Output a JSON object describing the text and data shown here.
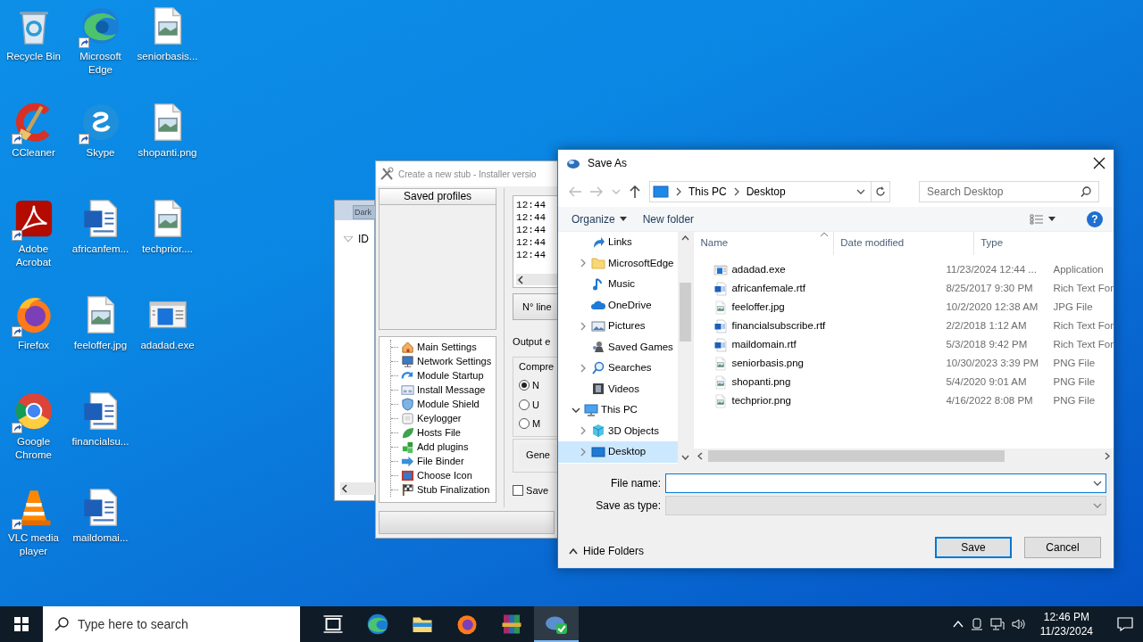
{
  "desktop_icons": [
    {
      "label": "Recycle Bin",
      "kind": "recycle",
      "shortcut": false
    },
    {
      "label": "CCleaner",
      "kind": "ccleaner",
      "shortcut": true
    },
    {
      "label": "Adobe Acrobat",
      "kind": "acrobat",
      "shortcut": true
    },
    {
      "label": "Firefox",
      "kind": "firefox",
      "shortcut": true
    },
    {
      "label": "Google Chrome",
      "kind": "chrome",
      "shortcut": true
    },
    {
      "label": "VLC media player",
      "kind": "vlc",
      "shortcut": true
    },
    {
      "label": "Microsoft Edge",
      "kind": "edge",
      "shortcut": true
    },
    {
      "label": "Skype",
      "kind": "skype",
      "shortcut": true
    },
    {
      "label": "africanfem...",
      "kind": "word",
      "shortcut": false
    },
    {
      "label": "feeloffer.jpg",
      "kind": "image",
      "shortcut": false
    },
    {
      "label": "financialsu...",
      "kind": "word",
      "shortcut": false
    },
    {
      "label": "maildomai...",
      "kind": "word",
      "shortcut": false
    },
    {
      "label": "seniorbasis...",
      "kind": "image",
      "shortcut": false
    },
    {
      "label": "shopanti.png",
      "kind": "image",
      "shortcut": false
    },
    {
      "label": "techprior....",
      "kind": "image",
      "shortcut": false
    },
    {
      "label": "adadad.exe",
      "kind": "exe",
      "shortcut": false
    }
  ],
  "back_window": {
    "button": "Dark",
    "column": "ID"
  },
  "stub_window": {
    "title": "Create a new stub - Installer versio",
    "profiles_header": "Saved profiles",
    "tree": [
      {
        "label": "Main Settings",
        "kind": "house"
      },
      {
        "label": "Network Settings",
        "kind": "monitor"
      },
      {
        "label": "Module Startup",
        "kind": "arrows"
      },
      {
        "label": "Install Message",
        "kind": "window"
      },
      {
        "label": "Module Shield",
        "kind": "shield"
      },
      {
        "label": "Keylogger",
        "kind": "key"
      },
      {
        "label": "Hosts File",
        "kind": "leaf"
      },
      {
        "label": "Add plugins",
        "kind": "puzzle"
      },
      {
        "label": "File Binder",
        "kind": "binder"
      },
      {
        "label": "Choose Icon",
        "kind": "picture"
      },
      {
        "label": "Stub Finalization",
        "kind": "flag"
      }
    ],
    "log_lines": [
      "12:44",
      "12:44",
      "12:44",
      "12:44",
      "12:44"
    ],
    "lines_button": "N° line",
    "output_label": "Output e",
    "compression_label": "Compre",
    "radios": [
      {
        "label": "N",
        "selected": true
      },
      {
        "label": "U",
        "selected": false
      },
      {
        "label": "M",
        "selected": false
      }
    ],
    "generate_button": "Gene",
    "save_checkbox": {
      "label": "Save",
      "checked": false
    }
  },
  "save_dialog": {
    "title": "Save As",
    "path": [
      "This PC",
      "Desktop"
    ],
    "search_placeholder": "Search Desktop",
    "toolbar": {
      "organize": "Organize",
      "new_folder": "New folder",
      "help": "?"
    },
    "nav_tree": [
      {
        "label": "Links",
        "kind": "links",
        "expandable": false,
        "selected": false
      },
      {
        "label": "MicrosoftEdge",
        "kind": "folder",
        "expandable": true,
        "expanded": false,
        "selected": false
      },
      {
        "label": "Music",
        "kind": "music",
        "expandable": false,
        "selected": false
      },
      {
        "label": "OneDrive",
        "kind": "onedrive",
        "expandable": false,
        "selected": false
      },
      {
        "label": "Pictures",
        "kind": "pictures",
        "expandable": true,
        "expanded": false,
        "selected": false
      },
      {
        "label": "Saved Games",
        "kind": "games",
        "expandable": false,
        "selected": false
      },
      {
        "label": "Searches",
        "kind": "searches",
        "expandable": true,
        "expanded": false,
        "selected": false
      },
      {
        "label": "Videos",
        "kind": "videos",
        "expandable": false,
        "selected": false
      },
      {
        "label": "This PC",
        "kind": "pc",
        "expandable": true,
        "expanded": true,
        "selected": false,
        "children": [
          {
            "label": "3D Objects",
            "kind": "objects3d",
            "expandable": true,
            "expanded": false,
            "selected": false
          },
          {
            "label": "Desktop",
            "kind": "desktop",
            "expandable": true,
            "expanded": false,
            "selected": true
          }
        ]
      }
    ],
    "columns": [
      "Name",
      "Date modified",
      "Type"
    ],
    "files": [
      {
        "name": "adadad.exe",
        "date": "11/23/2024 12:44 ...",
        "type": "Application",
        "kind": "exe"
      },
      {
        "name": "africanfemale.rtf",
        "date": "8/25/2017 9:30 PM",
        "type": "Rich Text For",
        "kind": "rtf"
      },
      {
        "name": "feeloffer.jpg",
        "date": "10/2/2020 12:38 AM",
        "type": "JPG File",
        "kind": "image"
      },
      {
        "name": "financialsubscribe.rtf",
        "date": "2/2/2018 1:12 AM",
        "type": "Rich Text For",
        "kind": "rtf"
      },
      {
        "name": "maildomain.rtf",
        "date": "5/3/2018 9:42 PM",
        "type": "Rich Text For",
        "kind": "rtf"
      },
      {
        "name": "seniorbasis.png",
        "date": "10/30/2023 3:39 PM",
        "type": "PNG File",
        "kind": "image"
      },
      {
        "name": "shopanti.png",
        "date": "5/4/2020 9:01 AM",
        "type": "PNG File",
        "kind": "image"
      },
      {
        "name": "techprior.png",
        "date": "4/16/2022 8:08 PM",
        "type": "PNG File",
        "kind": "image"
      }
    ],
    "file_name_label": "File name:",
    "file_name_focused": true,
    "save_type_label": "Save as type:",
    "save_type_disabled": true,
    "buttons": [
      {
        "label": "Save",
        "default": true
      },
      {
        "label": "Cancel",
        "default": false
      }
    ],
    "hide_folders": "Hide Folders"
  },
  "taskbar": {
    "search_placeholder": "Type here to search",
    "apps": [
      {
        "kind": "taskview",
        "active": false
      },
      {
        "kind": "edge",
        "active": false
      },
      {
        "kind": "explorer",
        "active": false
      },
      {
        "kind": "firefox",
        "active": false
      },
      {
        "kind": "winrar",
        "active": false
      },
      {
        "kind": "app",
        "active": true
      }
    ],
    "time": "12:46 PM",
    "date": "11/23/2024"
  }
}
